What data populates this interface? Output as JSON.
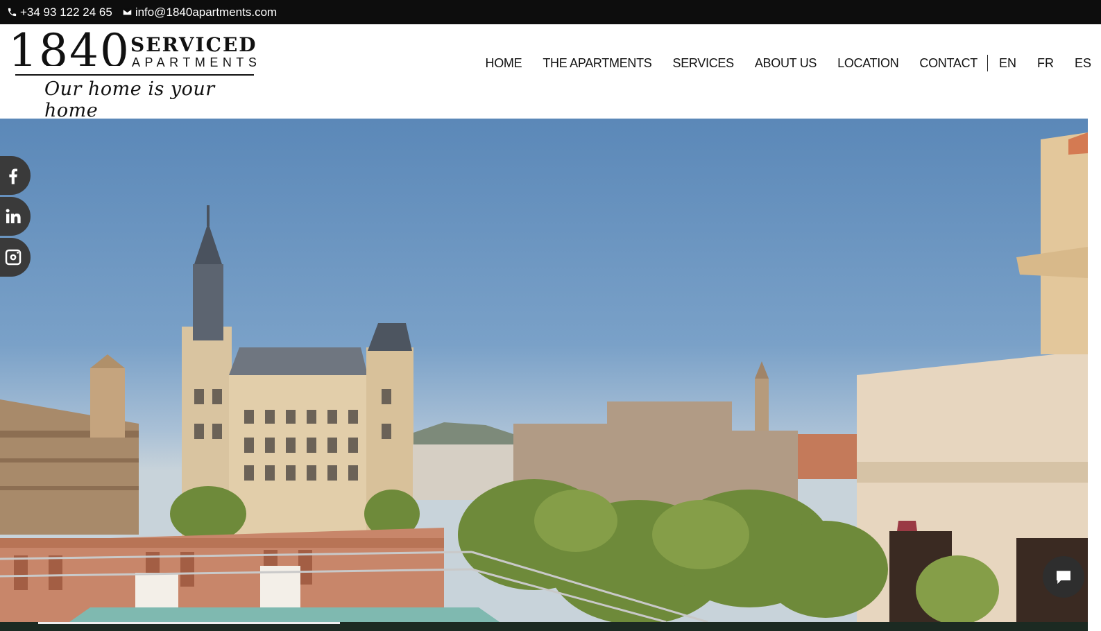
{
  "topbar": {
    "phone": "+34 93 122 24 65",
    "email": "info@1840apartments.com",
    "phone_icon": "phone-icon",
    "email_icon": "envelope-icon"
  },
  "logo": {
    "digits": "1840",
    "word1": "SERVICED",
    "word2": "APARTMENTS",
    "tagline": "Our home is your home"
  },
  "nav": {
    "items": [
      "HOME",
      "THE APARTMENTS",
      "SERVICES",
      "ABOUT US",
      "LOCATION",
      "CONTACT"
    ],
    "languages": [
      "EN",
      "FR",
      "ES"
    ]
  },
  "social": {
    "icons": [
      "facebook-icon",
      "linkedin-icon",
      "instagram-icon"
    ]
  },
  "chat": {
    "icon": "chat-bubble-icon"
  },
  "colors": {
    "topbar_bg": "#0d0d0d",
    "social_bg": "#3a3a3a",
    "chat_bg": "#2e2e2e"
  }
}
